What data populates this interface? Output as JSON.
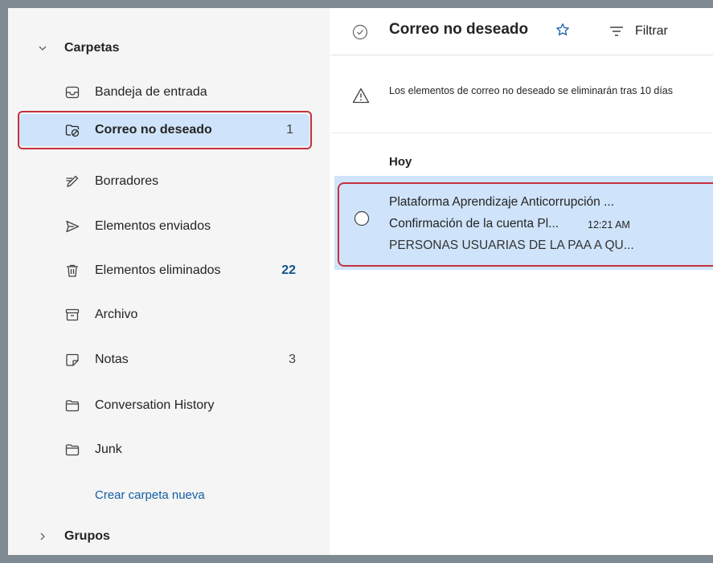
{
  "sidebar": {
    "folders_header": "Carpetas",
    "items": [
      {
        "label": "Bandeja de entrada",
        "count": ""
      },
      {
        "label": "Correo no deseado",
        "count": "1"
      },
      {
        "label": "Borradores",
        "count": ""
      },
      {
        "label": "Elementos enviados",
        "count": ""
      },
      {
        "label": "Elementos eliminados",
        "count": "22"
      },
      {
        "label": "Archivo",
        "count": ""
      },
      {
        "label": "Notas",
        "count": "3"
      },
      {
        "label": "Conversation History",
        "count": ""
      },
      {
        "label": "Junk",
        "count": ""
      }
    ],
    "create_folder": "Crear carpeta nueva",
    "groups_header": "Grupos"
  },
  "main": {
    "title": "Correo no deseado",
    "filter_label": "Filtrar",
    "notice": "Los elementos de correo no deseado se eliminarán tras 10 días",
    "group_label": "Hoy",
    "messages": [
      {
        "sender": "Plataforma Aprendizaje Anticorrupción ...",
        "subject": "Confirmación de la cuenta Pl...",
        "time": "12:21 AM",
        "preview": "PERSONAS USUARIAS DE LA PAA A QU..."
      }
    ]
  },
  "colors": {
    "selection": "#cfe4fa",
    "highlight_border": "#c5313d",
    "link": "#115ea3",
    "count_blue": "#0f548c"
  },
  "icons": [
    "chevron-down-icon",
    "inbox-icon",
    "junk-folder-icon",
    "pen-icon",
    "send-icon",
    "trash-icon",
    "archive-icon",
    "note-icon",
    "folder-icon",
    "chevron-right-icon",
    "check-circle-icon",
    "star-icon",
    "filter-icon",
    "warning-icon",
    "radio-icon"
  ]
}
